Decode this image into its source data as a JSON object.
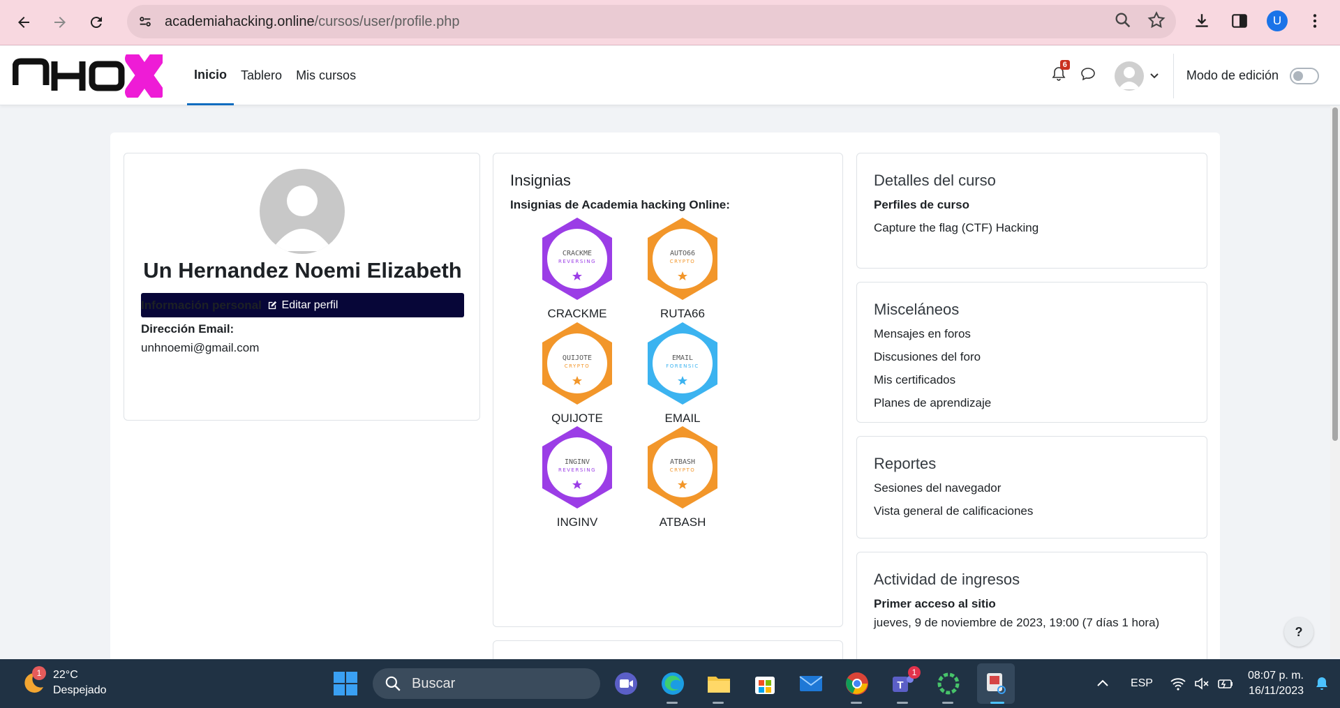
{
  "browser": {
    "url_domain": "academiahacking.online",
    "url_path": "/cursos/user/profile.php",
    "profile_initial": "U"
  },
  "site": {
    "logo_text": "AHO",
    "nav": [
      "Inicio",
      "Tablero",
      "Mis cursos"
    ],
    "notification_count": "6",
    "edit_mode_label": "Modo de edición"
  },
  "profile": {
    "name": "Un Hernandez Noemi Elizabeth",
    "edit_button": "Editar perfil",
    "personal_info_heading": "Información personal",
    "email_label": "Dirección Email:",
    "email_value": "unhnoemi@gmail.com"
  },
  "badges": {
    "title": "Insignias",
    "subtitle": "Insignias de Academia hacking Online:",
    "items": [
      {
        "name": "CRACKME",
        "logo": "CRACKME",
        "category": "REVERSING",
        "color": "#9b3de6"
      },
      {
        "name": "RUTA66",
        "logo": "AUTO66",
        "category": "CRYPTO",
        "color": "#f2962a"
      },
      {
        "name": "QUIJOTE",
        "logo": "QUIJOTE",
        "category": "CRYPTO",
        "color": "#f2962a"
      },
      {
        "name": "EMAIL",
        "logo": "EMAIL",
        "category": "FORENSIC",
        "color": "#3bb3f0"
      },
      {
        "name": "INGINV",
        "logo": "INGINV",
        "category": "REVERSING",
        "color": "#9b3de6"
      },
      {
        "name": "ATBASH",
        "logo": "ATBASH",
        "category": "CRYPTO",
        "color": "#f2962a"
      }
    ]
  },
  "course_details": {
    "title": "Detalles del curso",
    "heading": "Perfiles de curso",
    "course": "Capture the flag (CTF) Hacking"
  },
  "misc": {
    "title": "Misceláneos",
    "links": [
      "Mensajes en foros",
      "Discusiones del foro",
      "Mis certificados",
      "Planes de aprendizaje"
    ]
  },
  "reports": {
    "title": "Reportes",
    "links": [
      "Sesiones del navegador",
      "Vista general de calificaciones"
    ]
  },
  "login_activity": {
    "title": "Actividad de ingresos",
    "first_access_label": "Primer acceso al sitio",
    "first_access_value": "jueves, 9 de noviembre de 2023, 19:00  (7 días 1 hora)"
  },
  "help": "?",
  "taskbar": {
    "weather_temp": "22°C",
    "weather_desc": "Despejado",
    "weather_notif": "1",
    "search_placeholder": "Buscar",
    "teams_badge": "1",
    "language": "ESP",
    "time": "08:07 p. m.",
    "date": "16/11/2023"
  }
}
